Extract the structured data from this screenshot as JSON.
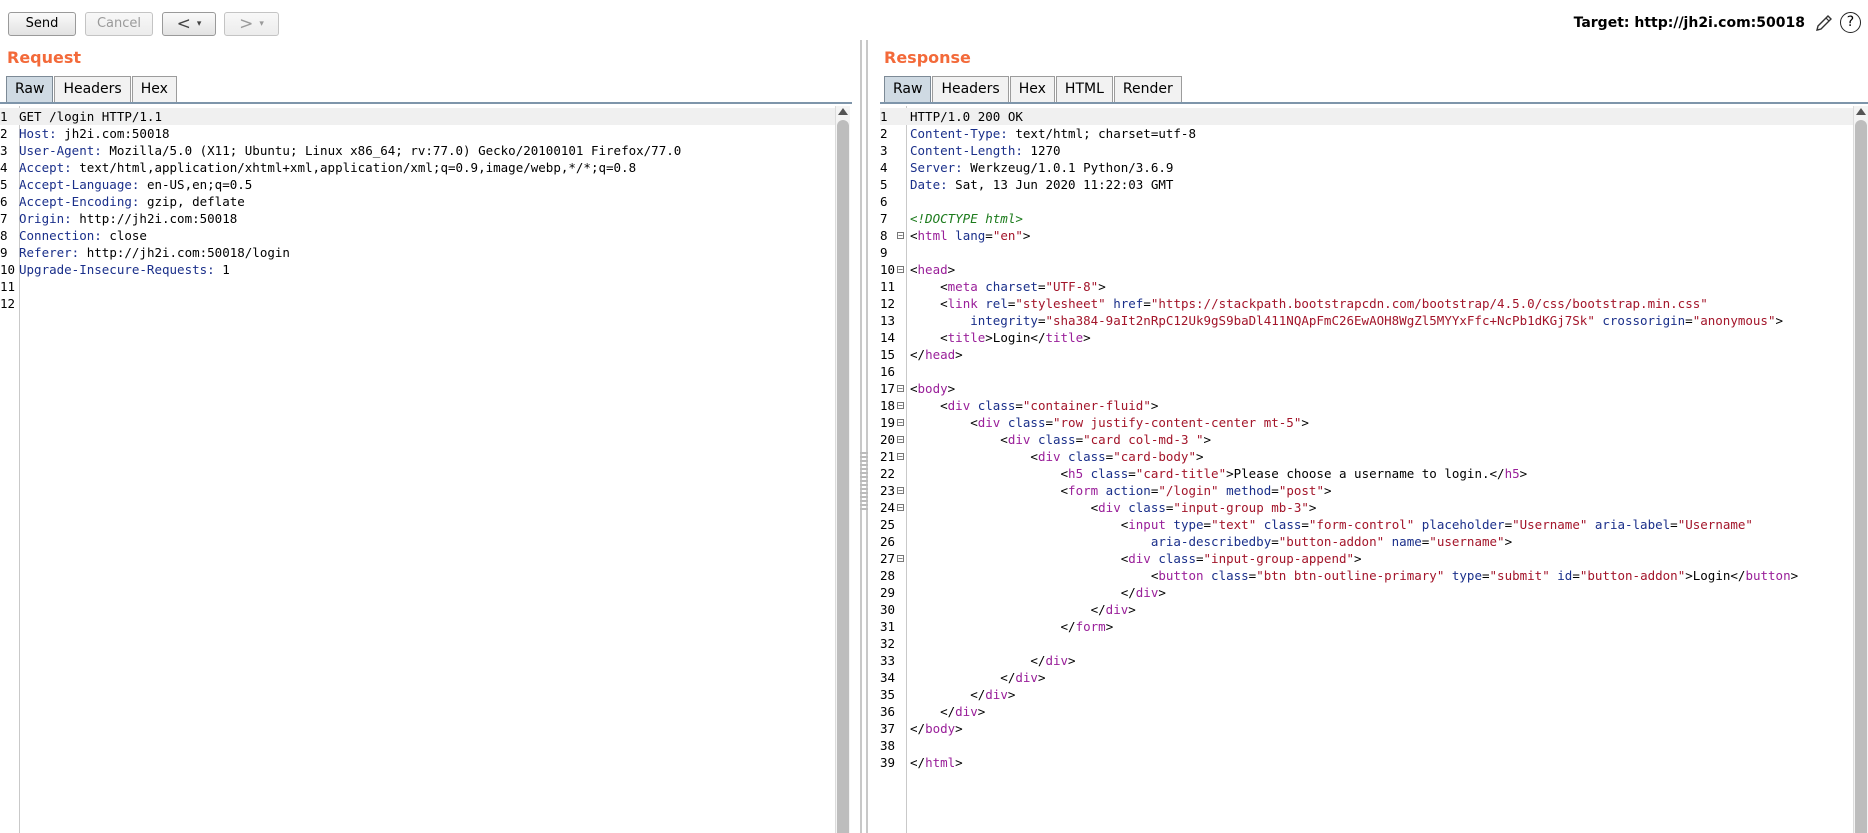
{
  "toolbar": {
    "send_label": "Send",
    "cancel_label": "Cancel",
    "back_arrow": "<",
    "forward_arrow": ">",
    "dropdown_glyph": "▾",
    "target_label": "Target: http://jh2i.com:50018",
    "help_glyph": "?"
  },
  "request": {
    "title": "Request",
    "tabs": [
      "Raw",
      "Headers",
      "Hex"
    ],
    "active_tab": "Raw",
    "lines": [
      [
        {
          "t": "GET /login HTTP/1.1",
          "c": ""
        }
      ],
      [
        {
          "t": "Host:",
          "c": "hk"
        },
        {
          "t": " jh2i.com:50018",
          "c": ""
        }
      ],
      [
        {
          "t": "User-Agent:",
          "c": "hk"
        },
        {
          "t": " Mozilla/5.0 (X11; Ubuntu; Linux x86_64; rv:77.0) Gecko/20100101 Firefox/77.0",
          "c": ""
        }
      ],
      [
        {
          "t": "Accept:",
          "c": "hk"
        },
        {
          "t": " text/html,application/xhtml+xml,application/xml;q=0.9,image/webp,*/*;q=0.8",
          "c": ""
        }
      ],
      [
        {
          "t": "Accept-Language:",
          "c": "hk"
        },
        {
          "t": " en-US,en;q=0.5",
          "c": ""
        }
      ],
      [
        {
          "t": "Accept-Encoding:",
          "c": "hk"
        },
        {
          "t": " gzip, deflate",
          "c": ""
        }
      ],
      [
        {
          "t": "Origin:",
          "c": "hk"
        },
        {
          "t": " http://jh2i.com:50018",
          "c": ""
        }
      ],
      [
        {
          "t": "Connection:",
          "c": "hk"
        },
        {
          "t": " close",
          "c": ""
        }
      ],
      [
        {
          "t": "Referer:",
          "c": "hk"
        },
        {
          "t": " http://jh2i.com:50018/login",
          "c": ""
        }
      ],
      [
        {
          "t": "Upgrade-Insecure-Requests:",
          "c": "hk"
        },
        {
          "t": " 1",
          "c": ""
        }
      ],
      [],
      []
    ]
  },
  "response": {
    "title": "Response",
    "tabs": [
      "Raw",
      "Headers",
      "Hex",
      "HTML",
      "Render"
    ],
    "active_tab": "Raw",
    "fold_lines": [
      8,
      10,
      17,
      18,
      19,
      20,
      21,
      23,
      24,
      27
    ],
    "lines": [
      [
        {
          "t": "HTTP/1.0 200 OK",
          "c": ""
        }
      ],
      [
        {
          "t": "Content-Type:",
          "c": "hk"
        },
        {
          "t": " text/html; charset=utf-8",
          "c": ""
        }
      ],
      [
        {
          "t": "Content-Length:",
          "c": "hk"
        },
        {
          "t": " 1270",
          "c": ""
        }
      ],
      [
        {
          "t": "Server:",
          "c": "hk"
        },
        {
          "t": " Werkzeug/1.0.1 Python/3.6.9",
          "c": ""
        }
      ],
      [
        {
          "t": "Date:",
          "c": "hk"
        },
        {
          "t": " Sat, 13 Jun 2020 11:22:03 GMT",
          "c": ""
        }
      ],
      [],
      [
        {
          "t": "<!DOCTYPE html>",
          "c": "cm"
        }
      ],
      [
        {
          "t": "<",
          "c": ""
        },
        {
          "t": "html",
          "c": "tg"
        },
        {
          "t": " lang",
          "c": "at"
        },
        {
          "t": "=",
          "c": ""
        },
        {
          "t": "\"en\"",
          "c": "av"
        },
        {
          "t": ">",
          "c": ""
        }
      ],
      [],
      [
        {
          "t": "<",
          "c": ""
        },
        {
          "t": "head",
          "c": "tg"
        },
        {
          "t": ">",
          "c": ""
        }
      ],
      [
        {
          "t": "    <",
          "c": ""
        },
        {
          "t": "meta",
          "c": "tg"
        },
        {
          "t": " charset",
          "c": "at"
        },
        {
          "t": "=",
          "c": ""
        },
        {
          "t": "\"UTF-8\"",
          "c": "av"
        },
        {
          "t": ">",
          "c": ""
        }
      ],
      [
        {
          "t": "    <",
          "c": ""
        },
        {
          "t": "link",
          "c": "tg"
        },
        {
          "t": " rel",
          "c": "at"
        },
        {
          "t": "=",
          "c": ""
        },
        {
          "t": "\"stylesheet\"",
          "c": "av"
        },
        {
          "t": " href",
          "c": "at"
        },
        {
          "t": "=",
          "c": ""
        },
        {
          "t": "\"https://stackpath.bootstrapcdn.com/bootstrap/4.5.0/css/bootstrap.min.css\"",
          "c": "av"
        }
      ],
      [
        {
          "t": "        integrity",
          "c": "at"
        },
        {
          "t": "=",
          "c": ""
        },
        {
          "t": "\"sha384-9aIt2nRpC12Uk9gS9baDl411NQApFmC26EwAOH8WgZl5MYYxFfc+NcPb1dKGj7Sk\"",
          "c": "av"
        },
        {
          "t": " crossorigin",
          "c": "at"
        },
        {
          "t": "=",
          "c": ""
        },
        {
          "t": "\"anonymous\"",
          "c": "av"
        },
        {
          "t": ">",
          "c": ""
        }
      ],
      [
        {
          "t": "    <",
          "c": ""
        },
        {
          "t": "title",
          "c": "tg"
        },
        {
          "t": ">Login</",
          "c": ""
        },
        {
          "t": "title",
          "c": "tg"
        },
        {
          "t": ">",
          "c": ""
        }
      ],
      [
        {
          "t": "</",
          "c": ""
        },
        {
          "t": "head",
          "c": "tg"
        },
        {
          "t": ">",
          "c": ""
        }
      ],
      [],
      [
        {
          "t": "<",
          "c": ""
        },
        {
          "t": "body",
          "c": "tg"
        },
        {
          "t": ">",
          "c": ""
        }
      ],
      [
        {
          "t": "    <",
          "c": ""
        },
        {
          "t": "div",
          "c": "tg"
        },
        {
          "t": " class",
          "c": "at"
        },
        {
          "t": "=",
          "c": ""
        },
        {
          "t": "\"container-fluid\"",
          "c": "av"
        },
        {
          "t": ">",
          "c": ""
        }
      ],
      [
        {
          "t": "        <",
          "c": ""
        },
        {
          "t": "div",
          "c": "tg"
        },
        {
          "t": " class",
          "c": "at"
        },
        {
          "t": "=",
          "c": ""
        },
        {
          "t": "\"row justify-content-center mt-5\"",
          "c": "av"
        },
        {
          "t": ">",
          "c": ""
        }
      ],
      [
        {
          "t": "            <",
          "c": ""
        },
        {
          "t": "div",
          "c": "tg"
        },
        {
          "t": " class",
          "c": "at"
        },
        {
          "t": "=",
          "c": ""
        },
        {
          "t": "\"card col-md-3 \"",
          "c": "av"
        },
        {
          "t": ">",
          "c": ""
        }
      ],
      [
        {
          "t": "                <",
          "c": ""
        },
        {
          "t": "div",
          "c": "tg"
        },
        {
          "t": " class",
          "c": "at"
        },
        {
          "t": "=",
          "c": ""
        },
        {
          "t": "\"card-body\"",
          "c": "av"
        },
        {
          "t": ">",
          "c": ""
        }
      ],
      [
        {
          "t": "                    <",
          "c": ""
        },
        {
          "t": "h5",
          "c": "tg"
        },
        {
          "t": " class",
          "c": "at"
        },
        {
          "t": "=",
          "c": ""
        },
        {
          "t": "\"card-title\"",
          "c": "av"
        },
        {
          "t": ">Please choose a username to login.</",
          "c": ""
        },
        {
          "t": "h5",
          "c": "tg"
        },
        {
          "t": ">",
          "c": ""
        }
      ],
      [
        {
          "t": "                    <",
          "c": ""
        },
        {
          "t": "form",
          "c": "tg"
        },
        {
          "t": " action",
          "c": "at"
        },
        {
          "t": "=",
          "c": ""
        },
        {
          "t": "\"/login\"",
          "c": "av"
        },
        {
          "t": " method",
          "c": "at"
        },
        {
          "t": "=",
          "c": ""
        },
        {
          "t": "\"post\"",
          "c": "av"
        },
        {
          "t": ">",
          "c": ""
        }
      ],
      [
        {
          "t": "                        <",
          "c": ""
        },
        {
          "t": "div",
          "c": "tg"
        },
        {
          "t": " class",
          "c": "at"
        },
        {
          "t": "=",
          "c": ""
        },
        {
          "t": "\"input-group mb-3\"",
          "c": "av"
        },
        {
          "t": ">",
          "c": ""
        }
      ],
      [
        {
          "t": "                            <",
          "c": ""
        },
        {
          "t": "input",
          "c": "tg"
        },
        {
          "t": " type",
          "c": "at"
        },
        {
          "t": "=",
          "c": ""
        },
        {
          "t": "\"text\"",
          "c": "av"
        },
        {
          "t": " class",
          "c": "at"
        },
        {
          "t": "=",
          "c": ""
        },
        {
          "t": "\"form-control\"",
          "c": "av"
        },
        {
          "t": " placeholder",
          "c": "at"
        },
        {
          "t": "=",
          "c": ""
        },
        {
          "t": "\"Username\"",
          "c": "av"
        },
        {
          "t": " aria-label",
          "c": "at"
        },
        {
          "t": "=",
          "c": ""
        },
        {
          "t": "\"Username\"",
          "c": "av"
        }
      ],
      [
        {
          "t": "                                aria-describedby",
          "c": "at"
        },
        {
          "t": "=",
          "c": ""
        },
        {
          "t": "\"button-addon\"",
          "c": "av"
        },
        {
          "t": " name",
          "c": "at"
        },
        {
          "t": "=",
          "c": ""
        },
        {
          "t": "\"username\"",
          "c": "av"
        },
        {
          "t": ">",
          "c": ""
        }
      ],
      [
        {
          "t": "                            <",
          "c": ""
        },
        {
          "t": "div",
          "c": "tg"
        },
        {
          "t": " class",
          "c": "at"
        },
        {
          "t": "=",
          "c": ""
        },
        {
          "t": "\"input-group-append\"",
          "c": "av"
        },
        {
          "t": ">",
          "c": ""
        }
      ],
      [
        {
          "t": "                                <",
          "c": ""
        },
        {
          "t": "button",
          "c": "tg"
        },
        {
          "t": " class",
          "c": "at"
        },
        {
          "t": "=",
          "c": ""
        },
        {
          "t": "\"btn btn-outline-primary\"",
          "c": "av"
        },
        {
          "t": " type",
          "c": "at"
        },
        {
          "t": "=",
          "c": ""
        },
        {
          "t": "\"submit\"",
          "c": "av"
        },
        {
          "t": " id",
          "c": "at"
        },
        {
          "t": "=",
          "c": ""
        },
        {
          "t": "\"button-addon\"",
          "c": "av"
        },
        {
          "t": ">Login</",
          "c": ""
        },
        {
          "t": "button",
          "c": "tg"
        },
        {
          "t": ">",
          "c": ""
        }
      ],
      [
        {
          "t": "                            </",
          "c": ""
        },
        {
          "t": "div",
          "c": "tg"
        },
        {
          "t": ">",
          "c": ""
        }
      ],
      [
        {
          "t": "                        </",
          "c": ""
        },
        {
          "t": "div",
          "c": "tg"
        },
        {
          "t": ">",
          "c": ""
        }
      ],
      [
        {
          "t": "                    </",
          "c": ""
        },
        {
          "t": "form",
          "c": "tg"
        },
        {
          "t": ">",
          "c": ""
        }
      ],
      [],
      [
        {
          "t": "                </",
          "c": ""
        },
        {
          "t": "div",
          "c": "tg"
        },
        {
          "t": ">",
          "c": ""
        }
      ],
      [
        {
          "t": "            </",
          "c": ""
        },
        {
          "t": "div",
          "c": "tg"
        },
        {
          "t": ">",
          "c": ""
        }
      ],
      [
        {
          "t": "        </",
          "c": ""
        },
        {
          "t": "div",
          "c": "tg"
        },
        {
          "t": ">",
          "c": ""
        }
      ],
      [
        {
          "t": "    </",
          "c": ""
        },
        {
          "t": "div",
          "c": "tg"
        },
        {
          "t": ">",
          "c": ""
        }
      ],
      [
        {
          "t": "</",
          "c": ""
        },
        {
          "t": "body",
          "c": "tg"
        },
        {
          "t": ">",
          "c": ""
        }
      ],
      [],
      [
        {
          "t": "</",
          "c": ""
        },
        {
          "t": "html",
          "c": "tg"
        },
        {
          "t": ">",
          "c": ""
        }
      ]
    ]
  },
  "colors": {
    "pane_title": "#f36a3a",
    "header_key": "#1a2f8a",
    "tag": "#9a209a",
    "attr_value": "#a3152a",
    "doctype": "#1b7a1b",
    "active_tab": "#cfdae3"
  },
  "icons": {
    "edit": "pencil-icon",
    "help": "help-icon"
  }
}
